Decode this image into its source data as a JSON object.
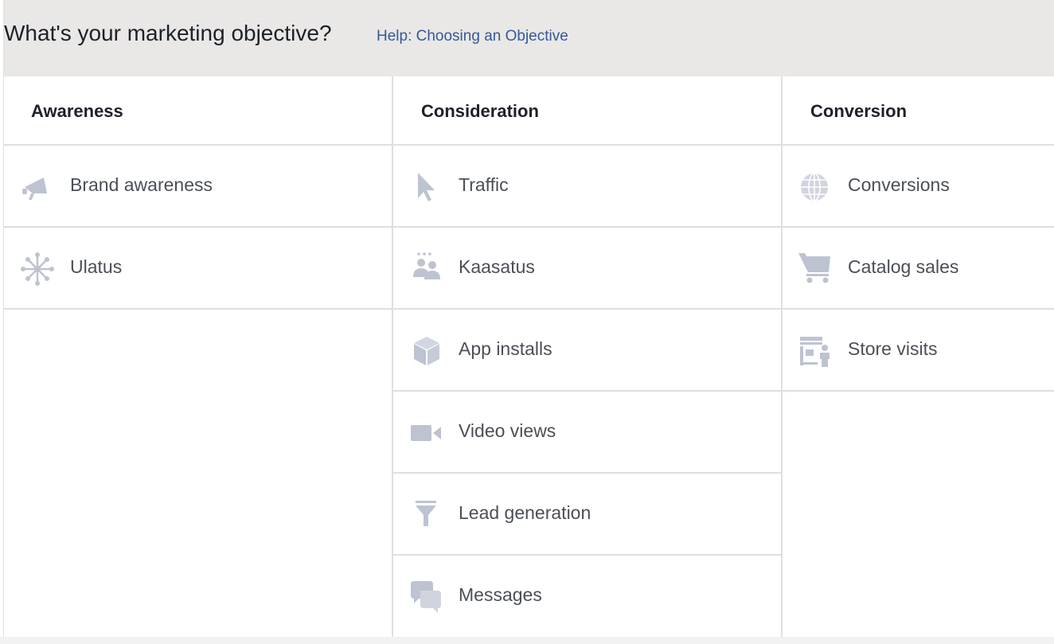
{
  "header": {
    "title": "What's your marketing objective?",
    "help_link": "Help: Choosing an Objective"
  },
  "colors": {
    "header_bg": "#e9e8e6",
    "link": "#365899",
    "icon": "#bec3d1",
    "divider": "#dddfe2",
    "text": "#4b4f56"
  },
  "columns": [
    {
      "title": "Awareness",
      "items": [
        {
          "label": "Brand awareness",
          "icon": "megaphone-icon"
        },
        {
          "label": "Ulatus",
          "icon": "reach-network-icon"
        }
      ]
    },
    {
      "title": "Consideration",
      "items": [
        {
          "label": "Traffic",
          "icon": "cursor-icon"
        },
        {
          "label": "Kaasatus",
          "icon": "people-icon"
        },
        {
          "label": "App installs",
          "icon": "box-icon"
        },
        {
          "label": "Video views",
          "icon": "video-camera-icon"
        },
        {
          "label": "Lead generation",
          "icon": "funnel-icon"
        },
        {
          "label": "Messages",
          "icon": "chat-bubbles-icon"
        }
      ]
    },
    {
      "title": "Conversion",
      "items": [
        {
          "label": "Conversions",
          "icon": "globe-icon"
        },
        {
          "label": "Catalog sales",
          "icon": "shopping-cart-icon"
        },
        {
          "label": "Store visits",
          "icon": "store-icon"
        }
      ]
    }
  ]
}
